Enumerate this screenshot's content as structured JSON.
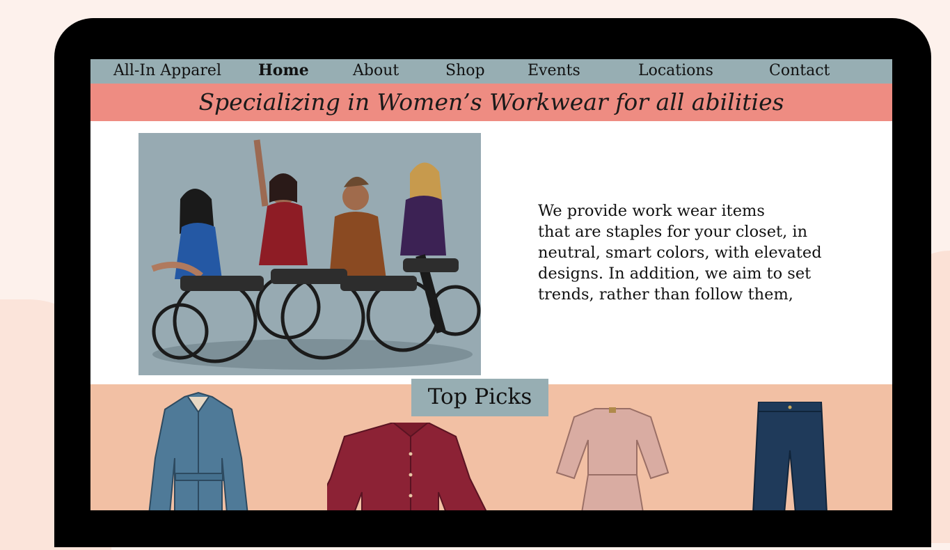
{
  "nav": {
    "brand": "All-In Apparel",
    "items": [
      {
        "label": "Home",
        "active": true
      },
      {
        "label": "About"
      },
      {
        "label": "Shop"
      },
      {
        "label": "Events"
      },
      {
        "label": "Locations"
      },
      {
        "label": "Contact"
      }
    ]
  },
  "tagline": "Specializing in Women’s Workwear for all abilities",
  "hero": {
    "image_alt": "Four women in wheelchairs posing together",
    "text_lines": [
      "We provide work wear items",
      "that are staples for your closet, in",
      "neutral, smart colors, with elevated",
      "designs. In addition, we aim to set",
      "trends, rather than follow them,"
    ]
  },
  "top_picks": {
    "title": "Top Picks",
    "products": [
      {
        "icon": "denim-shirt-dress-icon",
        "color": "#4f7a98"
      },
      {
        "icon": "red-blouse-icon",
        "color": "#8c2235"
      },
      {
        "icon": "pink-dress-icon",
        "color": "#d9aca2"
      },
      {
        "icon": "navy-jeans-icon",
        "color": "#1f3a5a"
      }
    ]
  },
  "colors": {
    "nav_bg": "#97aeb3",
    "tagline_bg": "#ee8c82",
    "picks_bg": "#f2c0a4",
    "page_bg": "#fdf1ec"
  }
}
